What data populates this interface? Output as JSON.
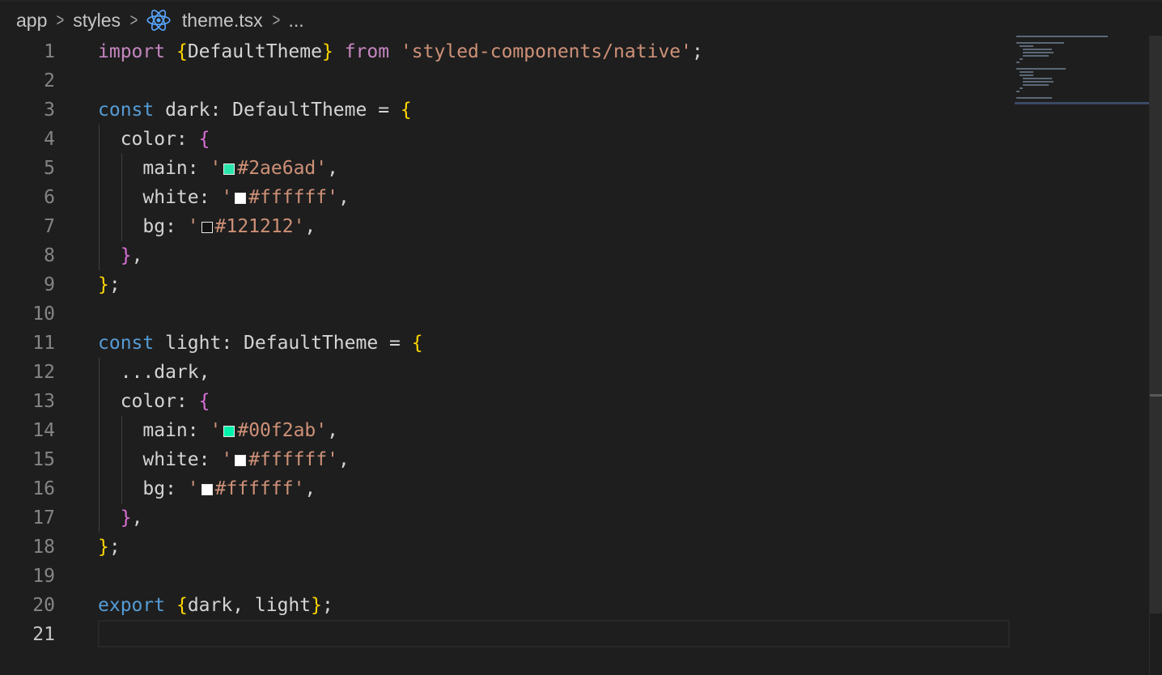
{
  "breadcrumb": {
    "items": [
      {
        "label": "app"
      },
      {
        "label": "styles"
      },
      {
        "label": "theme.tsx",
        "icon": "react-icon"
      },
      {
        "label": "..."
      }
    ],
    "separator": ">"
  },
  "editor": {
    "active_line": 21,
    "lines": [
      {
        "number": "1",
        "tokens": [
          {
            "t": "import",
            "c": "kw2"
          },
          {
            "t": " ",
            "c": "plain"
          },
          {
            "t": "{",
            "c": "b1"
          },
          {
            "t": "DefaultTheme",
            "c": "plain"
          },
          {
            "t": "}",
            "c": "b1"
          },
          {
            "t": " ",
            "c": "plain"
          },
          {
            "t": "from",
            "c": "kw2"
          },
          {
            "t": " ",
            "c": "plain"
          },
          {
            "t": "'styled-components/native'",
            "c": "str"
          },
          {
            "t": ";",
            "c": "plain"
          }
        ]
      },
      {
        "number": "2",
        "tokens": []
      },
      {
        "number": "3",
        "tokens": [
          {
            "t": "const",
            "c": "kw"
          },
          {
            "t": " dark: DefaultTheme = ",
            "c": "plain"
          },
          {
            "t": "{",
            "c": "b1"
          }
        ]
      },
      {
        "number": "4",
        "tokens": [
          {
            "t": "  color: ",
            "c": "plain"
          },
          {
            "t": "{",
            "c": "b2"
          }
        ]
      },
      {
        "number": "5",
        "tokens": [
          {
            "t": "    main: ",
            "c": "plain"
          },
          {
            "t": "'",
            "c": "str"
          },
          {
            "swatch": "#2ae6ad"
          },
          {
            "t": "#2ae6ad'",
            "c": "str"
          },
          {
            "t": ",",
            "c": "plain"
          }
        ]
      },
      {
        "number": "6",
        "tokens": [
          {
            "t": "    white: ",
            "c": "plain"
          },
          {
            "t": "'",
            "c": "str"
          },
          {
            "swatch": "#ffffff"
          },
          {
            "t": "#ffffff'",
            "c": "str"
          },
          {
            "t": ",",
            "c": "plain"
          }
        ]
      },
      {
        "number": "7",
        "tokens": [
          {
            "t": "    bg: ",
            "c": "plain"
          },
          {
            "t": "'",
            "c": "str"
          },
          {
            "swatch": "#121212"
          },
          {
            "t": "#121212'",
            "c": "str"
          },
          {
            "t": ",",
            "c": "plain"
          }
        ]
      },
      {
        "number": "8",
        "tokens": [
          {
            "t": "  ",
            "c": "plain"
          },
          {
            "t": "}",
            "c": "b2"
          },
          {
            "t": ",",
            "c": "plain"
          }
        ]
      },
      {
        "number": "9",
        "tokens": [
          {
            "t": "}",
            "c": "b1"
          },
          {
            "t": ";",
            "c": "plain"
          }
        ]
      },
      {
        "number": "10",
        "tokens": []
      },
      {
        "number": "11",
        "tokens": [
          {
            "t": "const",
            "c": "kw"
          },
          {
            "t": " light: DefaultTheme = ",
            "c": "plain"
          },
          {
            "t": "{",
            "c": "b1"
          }
        ]
      },
      {
        "number": "12",
        "tokens": [
          {
            "t": "  ...dark,",
            "c": "plain"
          }
        ]
      },
      {
        "number": "13",
        "tokens": [
          {
            "t": "  color: ",
            "c": "plain"
          },
          {
            "t": "{",
            "c": "b2"
          }
        ]
      },
      {
        "number": "14",
        "tokens": [
          {
            "t": "    main: ",
            "c": "plain"
          },
          {
            "t": "'",
            "c": "str"
          },
          {
            "swatch": "#00f2ab"
          },
          {
            "t": "#00f2ab'",
            "c": "str"
          },
          {
            "t": ",",
            "c": "plain"
          }
        ]
      },
      {
        "number": "15",
        "tokens": [
          {
            "t": "    white: ",
            "c": "plain"
          },
          {
            "t": "'",
            "c": "str"
          },
          {
            "swatch": "#ffffff"
          },
          {
            "t": "#ffffff'",
            "c": "str"
          },
          {
            "t": ",",
            "c": "plain"
          }
        ]
      },
      {
        "number": "16",
        "tokens": [
          {
            "t": "    bg: ",
            "c": "plain"
          },
          {
            "t": "'",
            "c": "str"
          },
          {
            "swatch": "#ffffff"
          },
          {
            "t": "#ffffff'",
            "c": "str"
          },
          {
            "t": ",",
            "c": "plain"
          }
        ]
      },
      {
        "number": "17",
        "tokens": [
          {
            "t": "  ",
            "c": "plain"
          },
          {
            "t": "}",
            "c": "b2"
          },
          {
            "t": ",",
            "c": "plain"
          }
        ]
      },
      {
        "number": "18",
        "tokens": [
          {
            "t": "}",
            "c": "b1"
          },
          {
            "t": ";",
            "c": "plain"
          }
        ]
      },
      {
        "number": "19",
        "tokens": []
      },
      {
        "number": "20",
        "tokens": [
          {
            "t": "export",
            "c": "kw"
          },
          {
            "t": " ",
            "c": "plain"
          },
          {
            "t": "{",
            "c": "b1"
          },
          {
            "t": "dark, light",
            "c": "plain"
          },
          {
            "t": "}",
            "c": "b1"
          },
          {
            "t": ";",
            "c": "plain"
          }
        ]
      },
      {
        "number": "21",
        "tokens": []
      }
    ]
  },
  "colors": {
    "background": "#1e1e1e",
    "keyword": "#569cd6",
    "import_keyword": "#c586c0",
    "string": "#ce9178",
    "bracket_level1": "#ffd700",
    "bracket_level2": "#da70d6",
    "line_number": "#858585"
  }
}
